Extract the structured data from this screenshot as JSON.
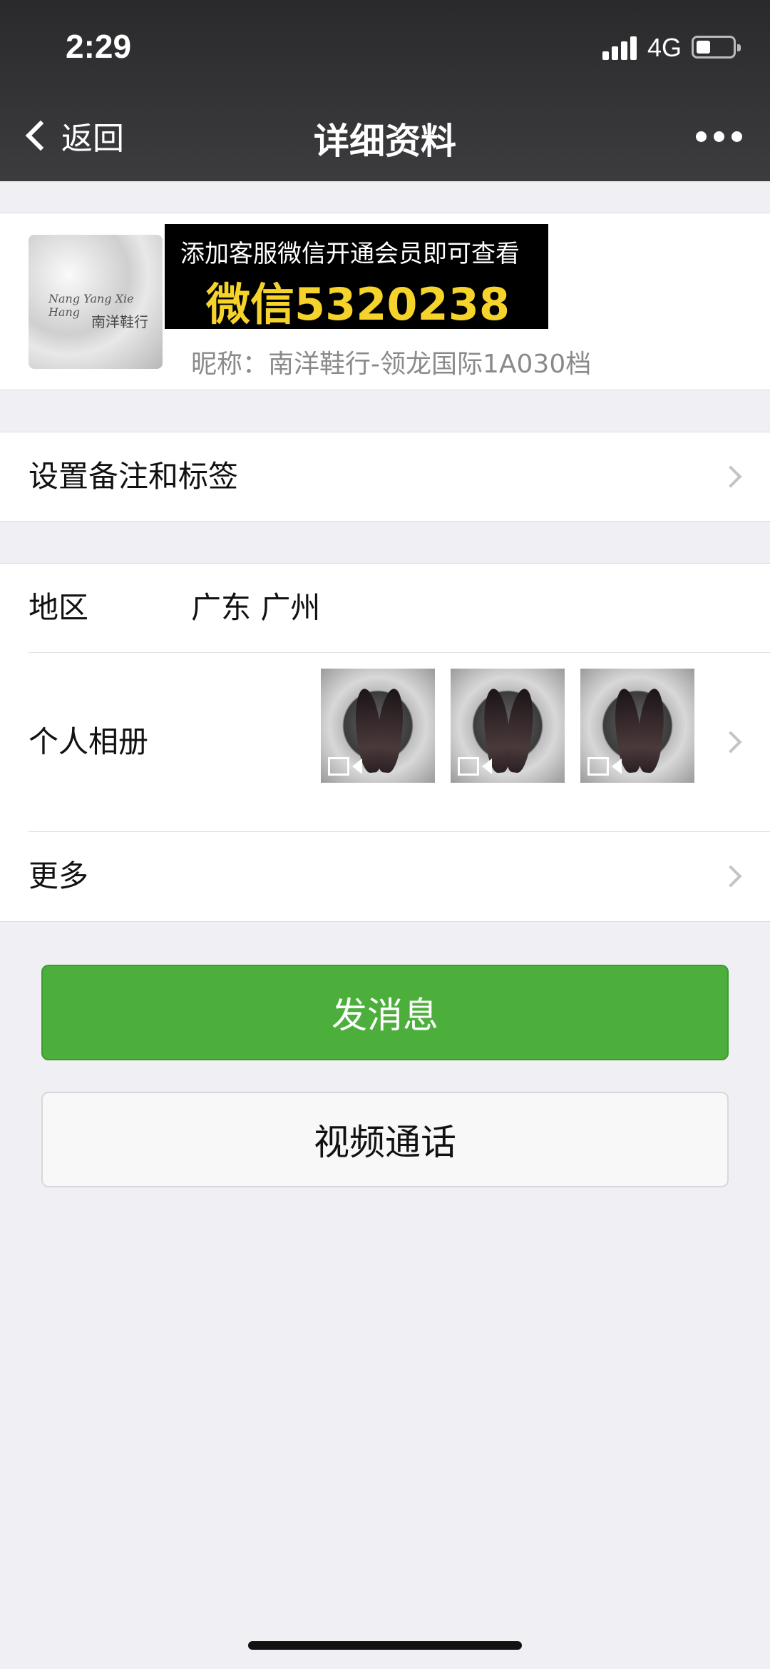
{
  "status_bar": {
    "time": "2:29",
    "network": "4G",
    "battery_level": 0.3
  },
  "nav": {
    "back_label": "返回",
    "title": "详细资料",
    "more_icon": "more-dots-icon"
  },
  "profile": {
    "avatar_script": "Nang Yang Xie Hang",
    "avatar_cn": "南洋鞋行",
    "promo_line1": "添加客服微信开通会员即可查看",
    "promo_line2": "微信5320238",
    "nickname": "昵称：南洋鞋行-领龙国际1A030档"
  },
  "rows": {
    "remark_label": "设置备注和标签",
    "region_label": "地区",
    "region_value": "广东 广州",
    "album_label": "个人相册",
    "more_label": "更多"
  },
  "actions": {
    "send_message": "发消息",
    "video_call": "视频通话"
  },
  "colors": {
    "header_bg": "#2d2d2f",
    "primary_green": "#4caf3c",
    "promo_yellow": "#f5d32a",
    "page_bg": "#efeff4"
  }
}
